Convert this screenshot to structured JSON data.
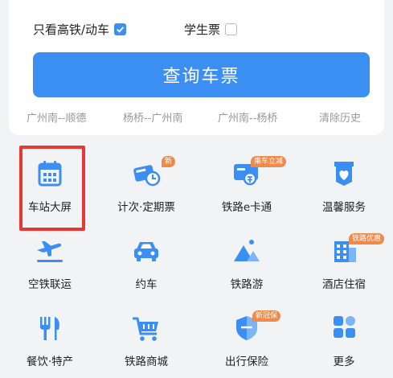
{
  "options": {
    "gaotie_label": "只看高铁/动车",
    "gaotie_checked": true,
    "student_label": "学生票",
    "student_checked": false
  },
  "search_button": "查询车票",
  "history": [
    "广州南--顺德",
    "杨桥--广州南",
    "广州南--杨桥"
  ],
  "clear_history": "清除历史",
  "services": [
    {
      "label": "车站大屏",
      "icon": "calendar-icon",
      "badge": ""
    },
    {
      "label": "计次·定期票",
      "icon": "ticket-clock-icon",
      "badge": "新"
    },
    {
      "label": "铁路e卡通",
      "icon": "e-card-icon",
      "badge": "乘车立减"
    },
    {
      "label": "温馨服务",
      "icon": "heart-box-icon",
      "badge": ""
    },
    {
      "label": "空铁联运",
      "icon": "airplane-icon",
      "badge": ""
    },
    {
      "label": "约车",
      "icon": "car-icon",
      "badge": ""
    },
    {
      "label": "铁路游",
      "icon": "mountain-icon",
      "badge": ""
    },
    {
      "label": "酒店住宿",
      "icon": "hotel-icon",
      "badge": "铁路优惠"
    },
    {
      "label": "餐饮·特产",
      "icon": "fork-knife-icon",
      "badge": ""
    },
    {
      "label": "铁路商城",
      "icon": "shopping-cart-icon",
      "badge": ""
    },
    {
      "label": "出行保险",
      "icon": "shield-icon",
      "badge": "新冠保"
    },
    {
      "label": "更多",
      "icon": "grid-icon",
      "badge": ""
    }
  ],
  "colors": {
    "primary": "#3b8ff2",
    "badge": "#f08a4b",
    "highlight": "#e53935"
  }
}
